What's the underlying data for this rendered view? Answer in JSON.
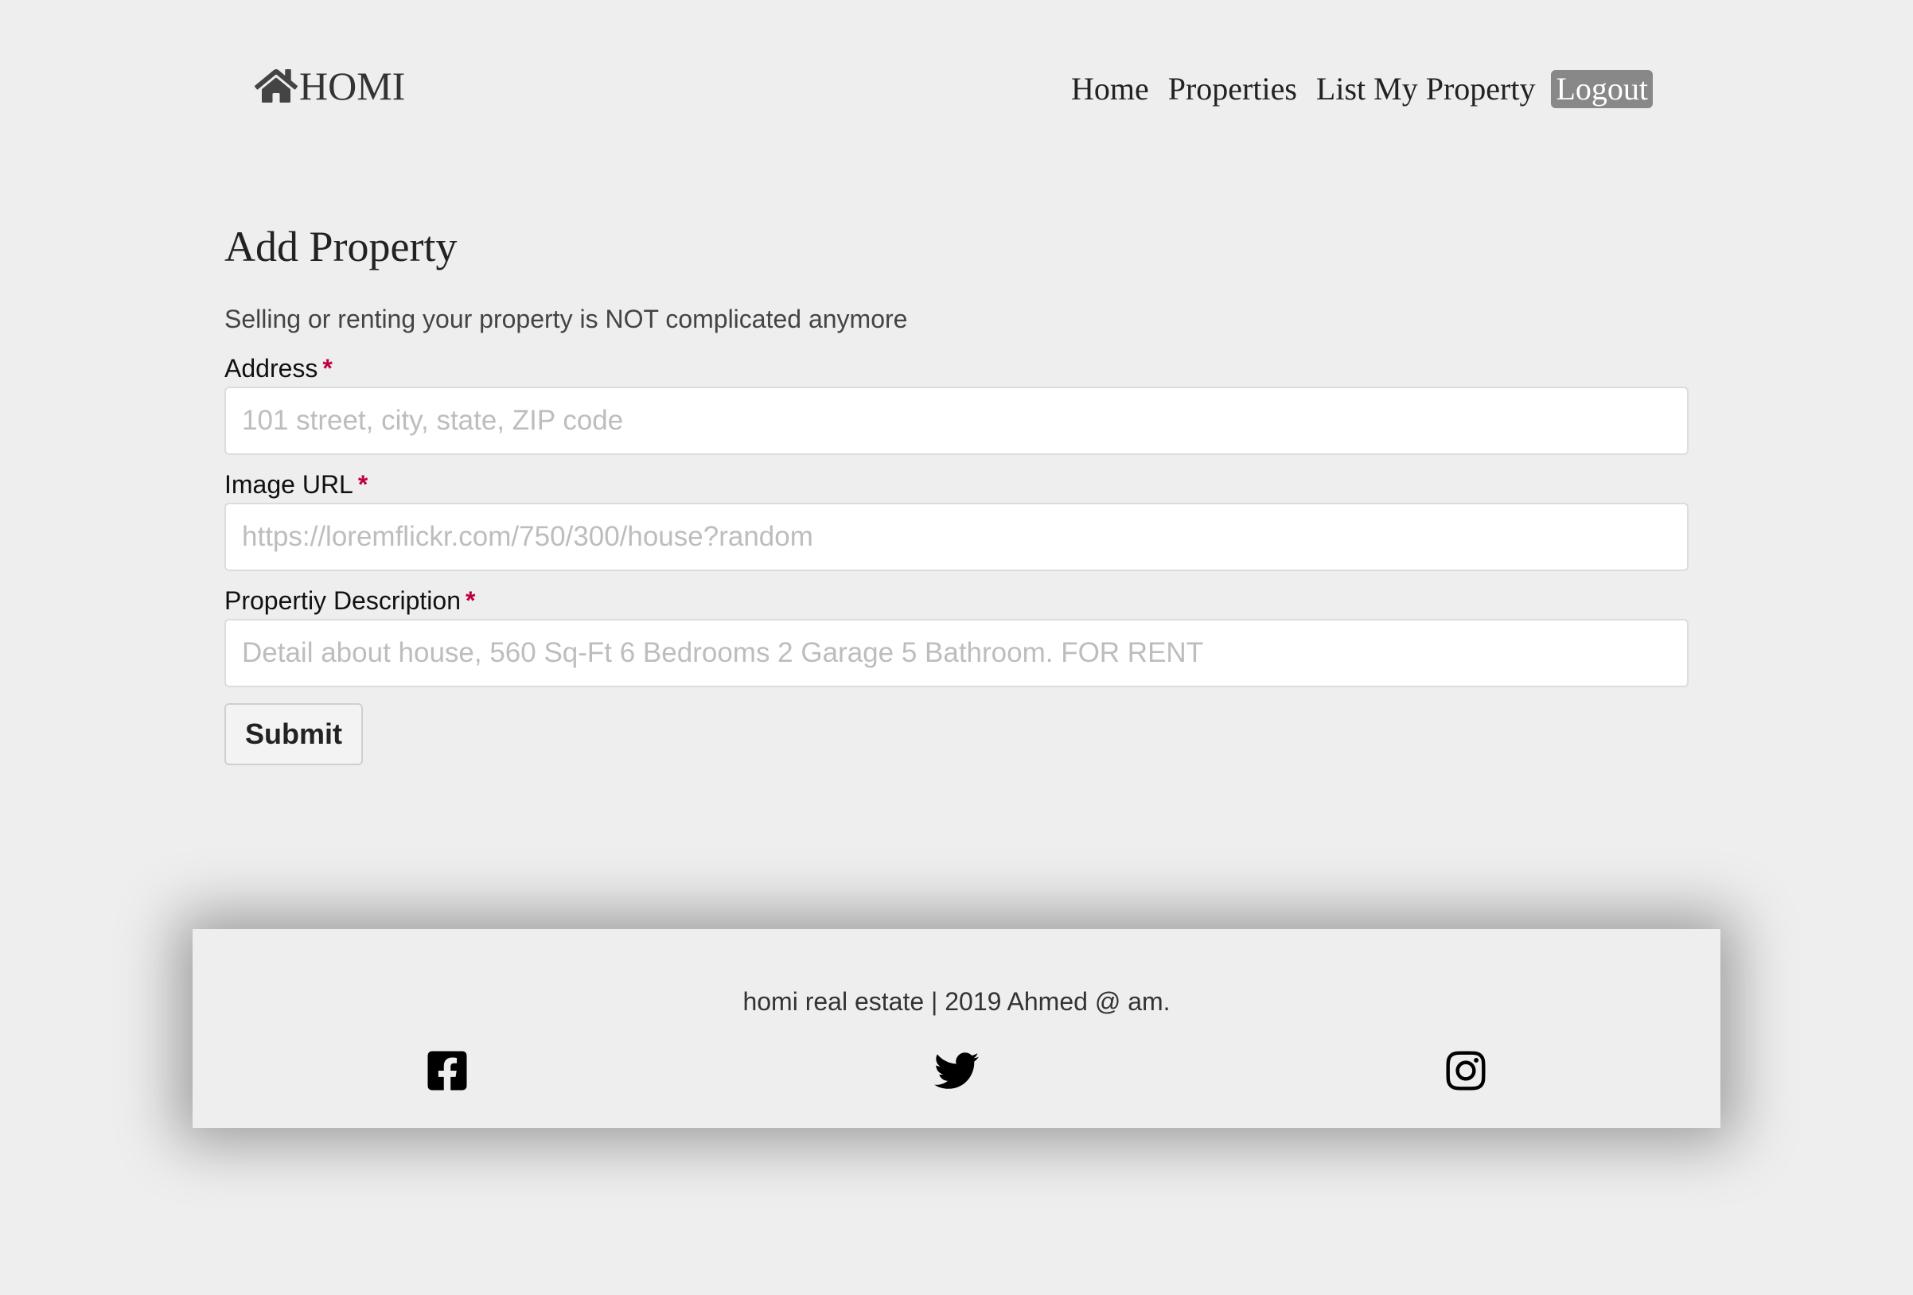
{
  "header": {
    "brand": "HOMI",
    "nav": {
      "home": "Home",
      "properties": "Properties",
      "list_my_property": "List My Property",
      "logout": "Logout"
    }
  },
  "form": {
    "title": "Add Property",
    "subtitle": "Selling or renting your property is NOT complicated anymore",
    "required_mark": "*",
    "fields": {
      "address": {
        "label": "Address",
        "value": "",
        "placeholder": "101 street, city, state, ZIP code"
      },
      "image_url": {
        "label": "Image URL",
        "value": "",
        "placeholder": "https://loremflickr.com/750/300/house?random"
      },
      "description": {
        "label": "Propertiy Description",
        "value": "",
        "placeholder": "Detail about house, 560 Sq-Ft 6 Bedrooms 2 Garage 5 Bathroom. FOR RENT"
      }
    },
    "submit_label": "Submit"
  },
  "footer": {
    "text": "homi real estate | 2019 Ahmed @ am.",
    "social_icons": [
      "facebook-icon",
      "twitter-icon",
      "instagram-icon"
    ]
  },
  "colors": {
    "background": "#eeeeee",
    "active_nav": "#888888",
    "required": "#c0003c"
  }
}
